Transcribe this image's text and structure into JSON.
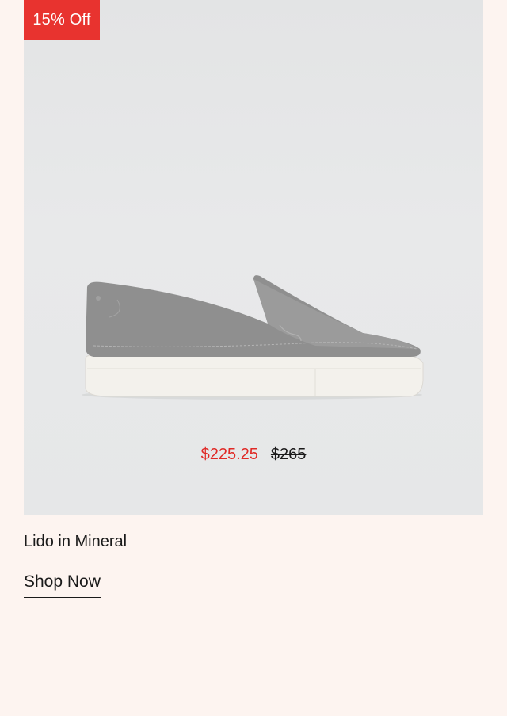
{
  "promo": {
    "badge_label": "15% Off",
    "badge_color": "#e8332f"
  },
  "product": {
    "image_icon": "slip-on-loafer-sneaker",
    "sale_price": "$225.25",
    "original_price": "$265",
    "name": "Lido in Mineral",
    "cta_label": "Shop Now",
    "sale_price_color": "#e02a26"
  }
}
